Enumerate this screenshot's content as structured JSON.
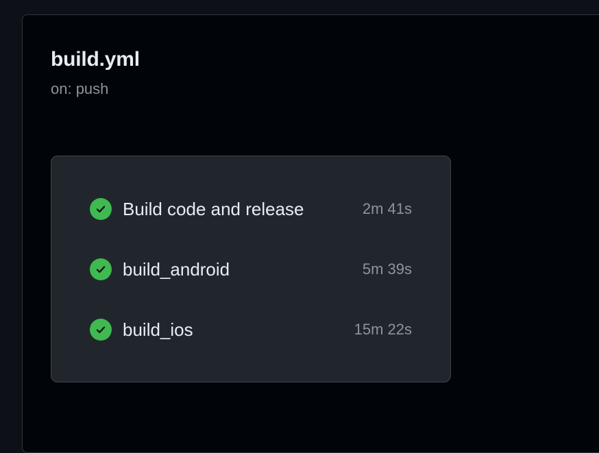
{
  "workflow": {
    "file_name": "build.yml",
    "trigger": "on: push"
  },
  "jobs": [
    {
      "name": "Build code and release",
      "duration": "2m 41s",
      "status": "success",
      "icon": "check-circle-icon"
    },
    {
      "name": "build_android",
      "duration": "5m 39s",
      "status": "success",
      "icon": "check-circle-icon"
    },
    {
      "name": "build_ios",
      "duration": "15m 22s",
      "status": "success",
      "icon": "check-circle-icon"
    }
  ],
  "colors": {
    "success": "#3fb950",
    "background": "#010409",
    "card": "#21262d"
  }
}
